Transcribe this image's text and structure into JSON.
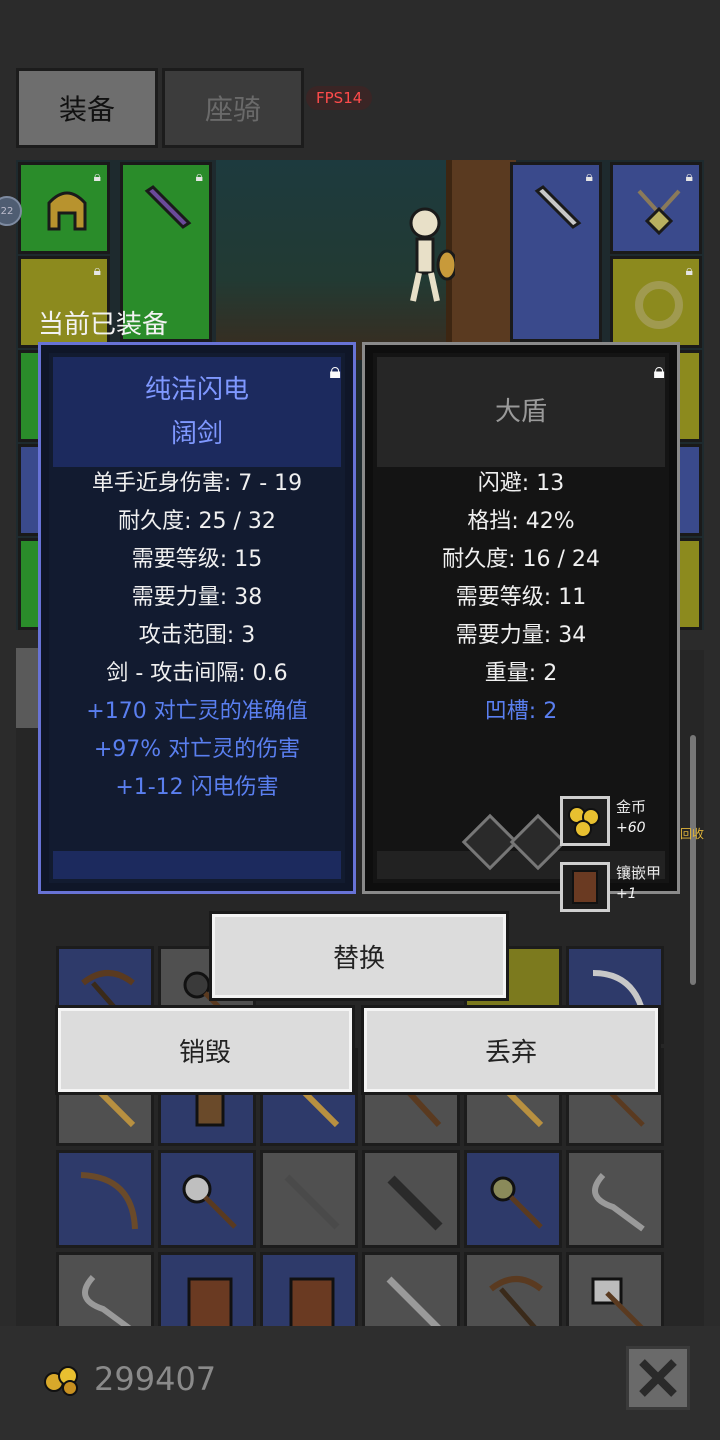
{
  "tabs": [
    {
      "label": "装备",
      "active": true
    },
    {
      "label": "座骑",
      "active": false
    }
  ],
  "fps": "FPS14",
  "level_badge": "22",
  "compare": {
    "title": "当前已装备",
    "equipped": {
      "name_line1": "纯洁闪电",
      "name_line2": "阔剑",
      "name_color": "#7f98ff",
      "stats": [
        "单手近身伤害: 7 - 19",
        "耐久度: 25 / 32",
        "需要等级: 15",
        "需要力量: 38",
        "攻击范围: 3",
        "剑 - 攻击间隔: 0.6"
      ],
      "magic_stats": [
        "+170 对亡灵的准确值",
        "+97% 对亡灵的伤害",
        "+1-12 闪电伤害"
      ],
      "locked": true
    },
    "candidate": {
      "name": "大盾",
      "stats": [
        "闪避: 13",
        "格挡: 42%",
        "耐久度: 16 / 24",
        "需要等级: 11",
        "需要力量: 34",
        "重量: 2"
      ],
      "magic_stats": [
        "凹槽: 2"
      ],
      "locked": true,
      "sockets": 2
    }
  },
  "drops": [
    {
      "name": "金币",
      "value": "+60",
      "icon": "gold-coins-icon"
    },
    {
      "name": "镶嵌甲",
      "value": "+1",
      "icon": "studded-armor-icon"
    }
  ],
  "recycle_label": "回收",
  "buttons": {
    "replace": "替换",
    "destroy": "销毁",
    "discard": "丢弃"
  },
  "footer": {
    "gold_amount": "299407"
  },
  "colors": {
    "magic": "#5a7ff0",
    "equipped_border": "#6873d6",
    "fps": "#ff4b4b"
  }
}
